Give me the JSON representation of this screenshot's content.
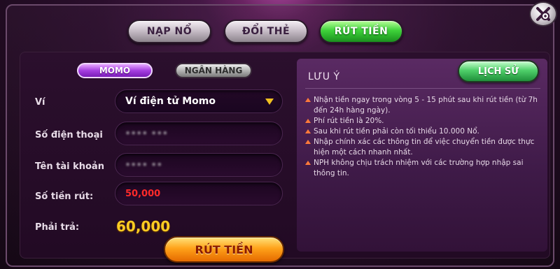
{
  "top_tabs": [
    {
      "label": "NẠP NỔ",
      "active": false
    },
    {
      "label": "ĐỔI THẺ",
      "active": false
    },
    {
      "label": "RÚT TIỀN",
      "active": true
    }
  ],
  "method_tabs": [
    {
      "label": "MOMO",
      "active": true
    },
    {
      "label": "NGÂN HÀNG",
      "active": false
    }
  ],
  "form": {
    "wallet_label": "Ví",
    "wallet_value": "Ví điện tử Momo",
    "phone_label": "Số điện thoại",
    "phone_value": "•••• •••",
    "account_label": "Tên tài khoản",
    "account_value": "•••• ••",
    "amount_label": "Số tiền rút:",
    "amount_value": "50,000",
    "pay_label": "Phải trả:",
    "pay_value": "60,000",
    "submit_label": "RÚT TIỀN"
  },
  "notes": {
    "title": "LƯU Ý",
    "history_label": "LỊCH SỬ",
    "items": [
      "Nhận tiền ngay trong vòng 5 - 15 phút sau khi rút tiền (từ 7h đến 24h hàng ngày).",
      "Phí rút tiền là 20%.",
      "Sau khi rút tiền phải còn tối thiểu 10.000 Nổ.",
      "Nhập chính xác các thông tin để việc chuyển tiền được thực hiện một cách nhanh nhất.",
      "NPH không chịu trách nhiệm với các trường hợp nhập sai thông tin."
    ]
  },
  "colors": {
    "accent_green": "#3ed23a",
    "accent_purple": "#a53ee0",
    "accent_orange": "#ffa31a",
    "amount_red": "#ff2a2a",
    "pay_yellow": "#ffcc22"
  },
  "icons": {
    "close": "close-zoom-icon",
    "dropdown": "dropdown-arrow-icon",
    "bullet": "triangle-bullet-icon"
  }
}
